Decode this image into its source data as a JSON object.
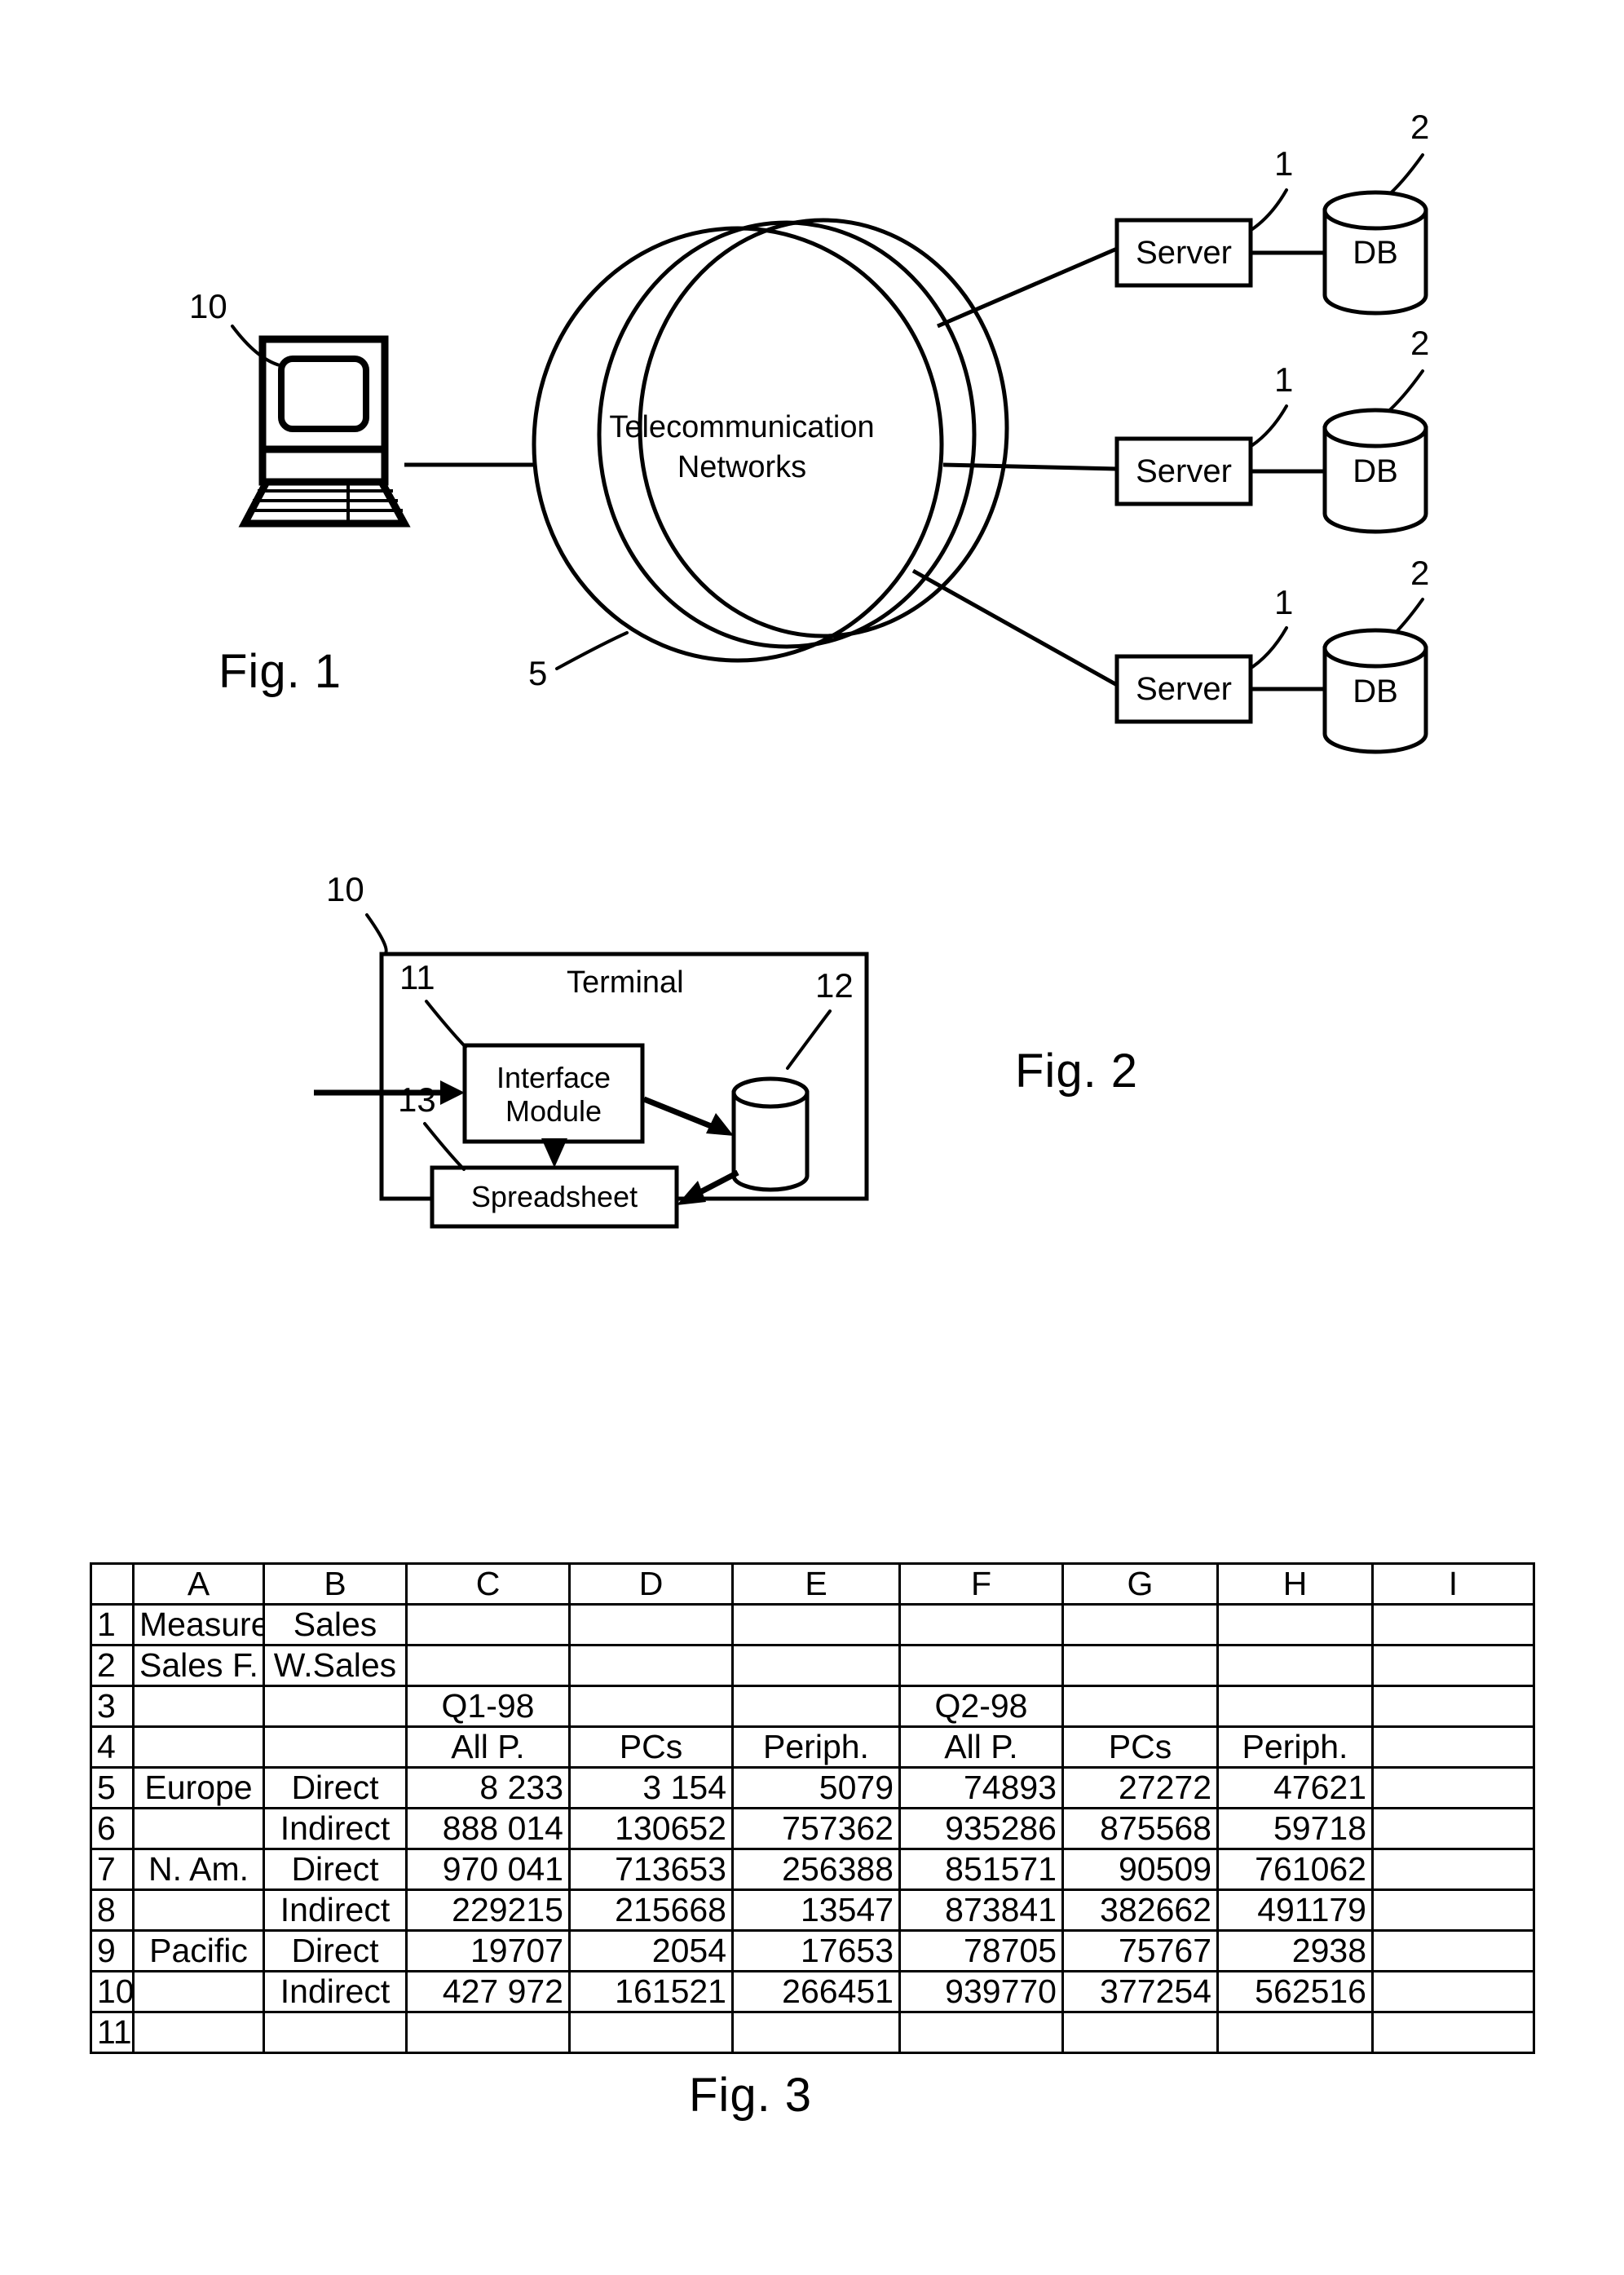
{
  "figures": {
    "fig1": {
      "label": "Fig. 1",
      "cloud_line1": "Telecommunication",
      "cloud_line2": "Networks",
      "cloud_ref": "5",
      "terminal_ref": "10",
      "servers": [
        {
          "label": "Server",
          "ref": "1",
          "db_label": "DB",
          "db_ref": "2"
        },
        {
          "label": "Server",
          "ref": "1",
          "db_label": "DB",
          "db_ref": "2"
        },
        {
          "label": "Server",
          "ref": "1",
          "db_label": "DB",
          "db_ref": "2"
        }
      ]
    },
    "fig2": {
      "label": "Fig. 2",
      "frame_title": "Terminal",
      "frame_ref": "10",
      "interface_module": "Interface\nModule",
      "interface_module_line1": "Interface",
      "interface_module_line2": "Module",
      "interface_ref": "11",
      "store_ref": "12",
      "spreadsheet": "Spreadsheet",
      "spreadsheet_ref": "13"
    },
    "fig3": {
      "label": "Fig. 3"
    }
  },
  "spreadsheet": {
    "column_headers": [
      "A",
      "B",
      "C",
      "D",
      "E",
      "F",
      "G",
      "H",
      "I"
    ],
    "row_numbers": [
      "1",
      "2",
      "3",
      "4",
      "5",
      "6",
      "7",
      "8",
      "9",
      "10",
      "11"
    ],
    "rows": [
      {
        "n": "1",
        "cells": [
          "Measure",
          "Sales",
          "",
          "",
          "",
          "",
          "",
          "",
          ""
        ]
      },
      {
        "n": "2",
        "cells": [
          "Sales F.",
          "W.Sales",
          "",
          "",
          "",
          "",
          "",
          "",
          ""
        ]
      },
      {
        "n": "3",
        "cells": [
          "",
          "",
          "Q1-98",
          "",
          "",
          "Q2-98",
          "",
          "",
          ""
        ]
      },
      {
        "n": "4",
        "cells": [
          "",
          "",
          "All P.",
          "PCs",
          "Periph.",
          "All P.",
          "PCs",
          "Periph.",
          ""
        ]
      },
      {
        "n": "5",
        "cells": [
          "Europe",
          "Direct",
          "8 233",
          "3 154",
          "5079",
          "74893",
          "27272",
          "47621",
          ""
        ]
      },
      {
        "n": "6",
        "cells": [
          "",
          "Indirect",
          "888 014",
          "130652",
          "757362",
          "935286",
          "875568",
          "59718",
          ""
        ]
      },
      {
        "n": "7",
        "cells": [
          "N. Am.",
          "Direct",
          "970 041",
          "713653",
          "256388",
          "851571",
          "90509",
          "761062",
          ""
        ]
      },
      {
        "n": "8",
        "cells": [
          "",
          "Indirect",
          "229215",
          "215668",
          "13547",
          "873841",
          "382662",
          "491179",
          ""
        ]
      },
      {
        "n": "9",
        "cells": [
          "Pacific",
          "Direct",
          "19707",
          "2054",
          "17653",
          "78705",
          "75767",
          "2938",
          ""
        ]
      },
      {
        "n": "10",
        "cells": [
          "",
          "Indirect",
          "427 972",
          "161521",
          "266451",
          "939770",
          "377254",
          "562516",
          ""
        ]
      },
      {
        "n": "11",
        "cells": [
          "",
          "",
          "",
          "",
          "",
          "",
          "",
          "",
          ""
        ]
      }
    ],
    "cell_alignments": [
      [
        "txt",
        "txt",
        "txt",
        "txt",
        "txt",
        "txt",
        "txt",
        "txt",
        "txt"
      ],
      [
        "txt",
        "txt",
        "txt",
        "txt",
        "txt",
        "txt",
        "txt",
        "txt",
        "txt"
      ],
      [
        "txt",
        "txt",
        "txt",
        "txt",
        "txt",
        "txt",
        "txt",
        "txt",
        "txt"
      ],
      [
        "txt",
        "txt",
        "txt",
        "txt",
        "txt",
        "txt",
        "txt",
        "txt",
        "txt"
      ],
      [
        "txt",
        "txt",
        "num",
        "num",
        "num",
        "num",
        "num",
        "num",
        "txt"
      ],
      [
        "txt",
        "txt",
        "num",
        "num",
        "num",
        "num",
        "num",
        "num",
        "txt"
      ],
      [
        "txt",
        "txt",
        "num",
        "num",
        "num",
        "num",
        "num",
        "num",
        "txt"
      ],
      [
        "txt",
        "txt",
        "num",
        "num",
        "num",
        "num",
        "num",
        "num",
        "txt"
      ],
      [
        "txt",
        "txt",
        "num",
        "num",
        "num",
        "num",
        "num",
        "num",
        "txt"
      ],
      [
        "txt",
        "txt",
        "num",
        "num",
        "num",
        "num",
        "num",
        "num",
        "txt"
      ],
      [
        "txt",
        "txt",
        "txt",
        "txt",
        "txt",
        "txt",
        "txt",
        "txt",
        "txt"
      ]
    ]
  },
  "colors": {
    "ink": "#000000",
    "paper": "#ffffff"
  }
}
